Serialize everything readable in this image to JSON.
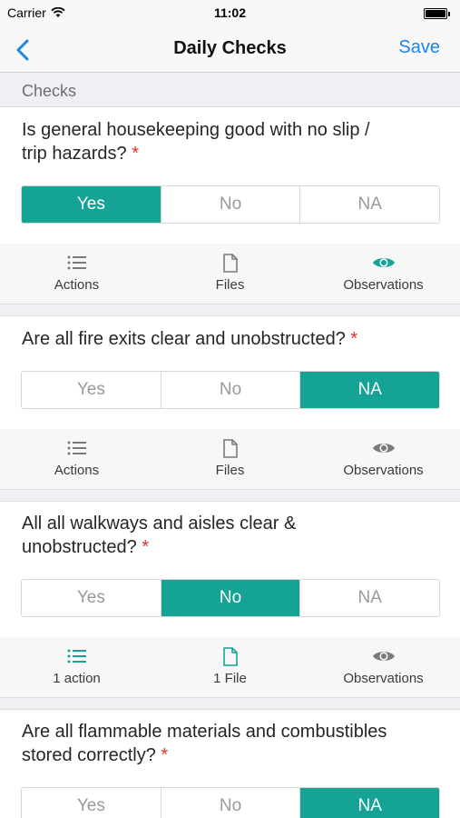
{
  "status_bar": {
    "carrier": "Carrier",
    "time": "11:02"
  },
  "nav": {
    "title": "Daily Checks",
    "save_label": "Save"
  },
  "section": {
    "title": "Checks"
  },
  "colors": {
    "accent": "#14a394",
    "link": "#1a86e8",
    "required": "#e0302d"
  },
  "options": [
    "Yes",
    "No",
    "NA"
  ],
  "questions": [
    {
      "line1": "Is general housekeeping good with no slip /",
      "line2": "trip hazards?",
      "required_mark": "*",
      "selected": "Yes",
      "actions": {
        "label": "Actions",
        "icon": "list-icon",
        "active": false
      },
      "files": {
        "label": "Files",
        "icon": "file-icon",
        "active": false
      },
      "observations": {
        "label": "Observations",
        "icon": "eye-icon",
        "active": true
      }
    },
    {
      "line1": "Are all fire exits clear and unobstructed?",
      "line2": "",
      "required_mark": "*",
      "selected": "NA",
      "actions": {
        "label": "Actions",
        "icon": "list-icon",
        "active": false
      },
      "files": {
        "label": "Files",
        "icon": "file-icon",
        "active": false
      },
      "observations": {
        "label": "Observations",
        "icon": "eye-icon",
        "active": false
      }
    },
    {
      "line1": "All all walkways and aisles clear &",
      "line2": "unobstructed?",
      "required_mark": "*",
      "selected": "No",
      "actions": {
        "label": "1 action",
        "icon": "list-icon",
        "active": true
      },
      "files": {
        "label": "1 File",
        "icon": "file-icon",
        "active": true
      },
      "observations": {
        "label": "Observations",
        "icon": "eye-icon",
        "active": false
      }
    },
    {
      "line1": "Are all flammable materials and combustibles",
      "line2": "stored correctly?",
      "required_mark": "*",
      "selected": "NA"
    }
  ]
}
